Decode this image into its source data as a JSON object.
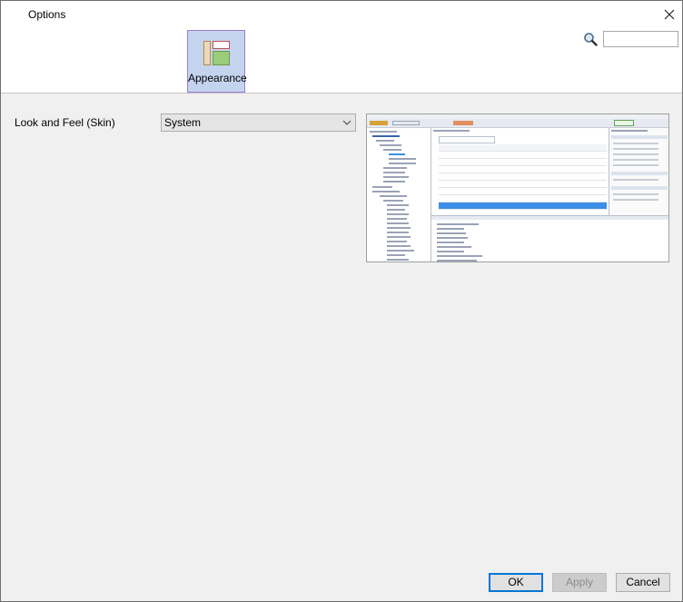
{
  "window": {
    "title": "Options",
    "close_icon": "close-icon"
  },
  "search": {
    "icon": "search-icon",
    "value": "",
    "placeholder": ""
  },
  "categories": [
    {
      "label": "Appearance",
      "icon": "appearance-icon",
      "selected": true
    }
  ],
  "appearance": {
    "look_and_feel_label": "Look and Feel (Skin)",
    "skin_selected": "System",
    "preview_alt": "Skin preview screenshot"
  },
  "colors": {
    "selected_category_bg": "#c5d4ee",
    "selected_category_border": "#9c7ed0",
    "ok_border": "#0078d7"
  },
  "buttons": {
    "ok": "OK",
    "apply": "Apply",
    "cancel": "Cancel"
  }
}
